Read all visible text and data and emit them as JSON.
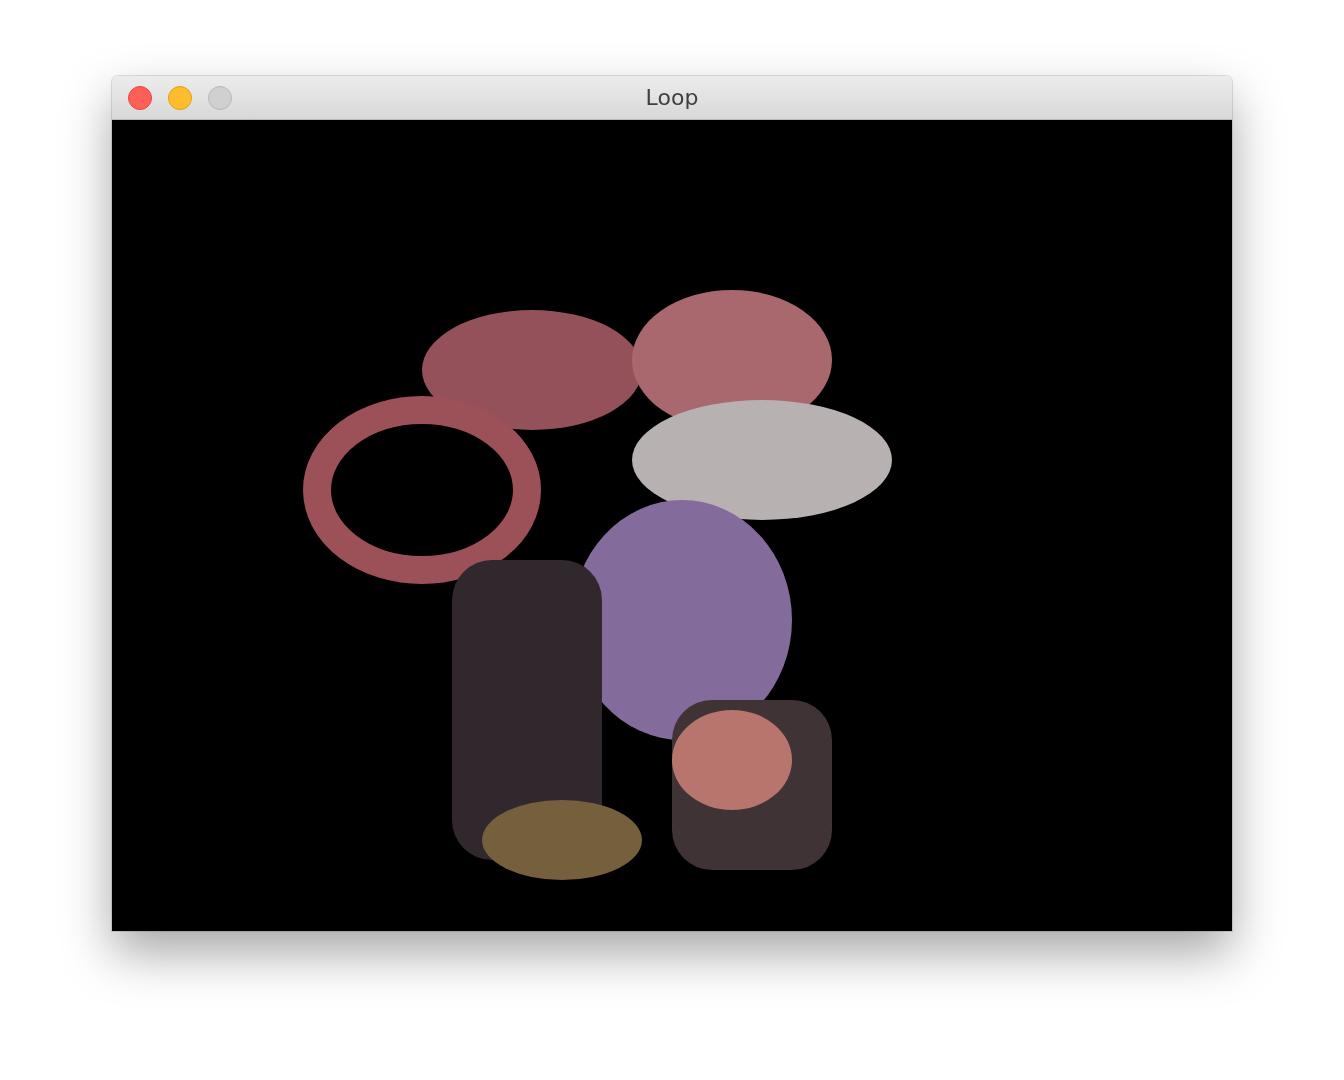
{
  "window": {
    "title": "Loop"
  }
}
